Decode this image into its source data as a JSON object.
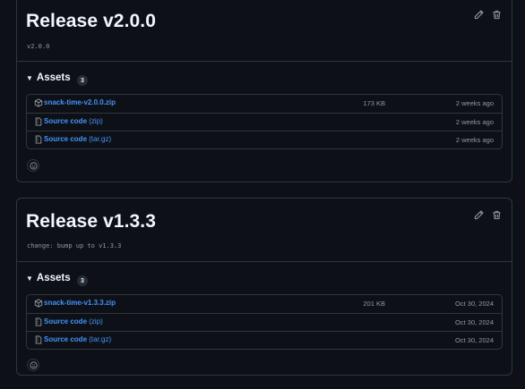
{
  "colors": {
    "background": "#0d1117",
    "border": "#30363d",
    "link": "#4493f8",
    "muted": "#9198a1",
    "title": "#f0f6fc"
  },
  "releases": [
    {
      "title": "Release v2.0.0",
      "description": "v2.0.0",
      "assets_label": "Assets",
      "asset_count": "3",
      "assets": [
        {
          "icon": "package-icon",
          "name": "snack-time-v2.0.0.zip",
          "suffix": "",
          "size": "173 KB",
          "date": "2 weeks ago"
        },
        {
          "icon": "file-zip-icon",
          "name": "Source code",
          "suffix": "(zip)",
          "size": "",
          "date": "2 weeks ago"
        },
        {
          "icon": "file-zip-icon",
          "name": "Source code",
          "suffix": "(tar.gz)",
          "size": "",
          "date": "2 weeks ago"
        }
      ]
    },
    {
      "title": "Release v1.3.3",
      "description": "change: bump up to v1.3.3",
      "assets_label": "Assets",
      "asset_count": "3",
      "assets": [
        {
          "icon": "package-icon",
          "name": "snack-time-v1.3.3.zip",
          "suffix": "",
          "size": "201 KB",
          "date": "Oct 30, 2024"
        },
        {
          "icon": "file-zip-icon",
          "name": "Source code",
          "suffix": "(zip)",
          "size": "",
          "date": "Oct 30, 2024"
        },
        {
          "icon": "file-zip-icon",
          "name": "Source code",
          "suffix": "(tar.gz)",
          "size": "",
          "date": "Oct 30, 2024"
        }
      ]
    }
  ]
}
